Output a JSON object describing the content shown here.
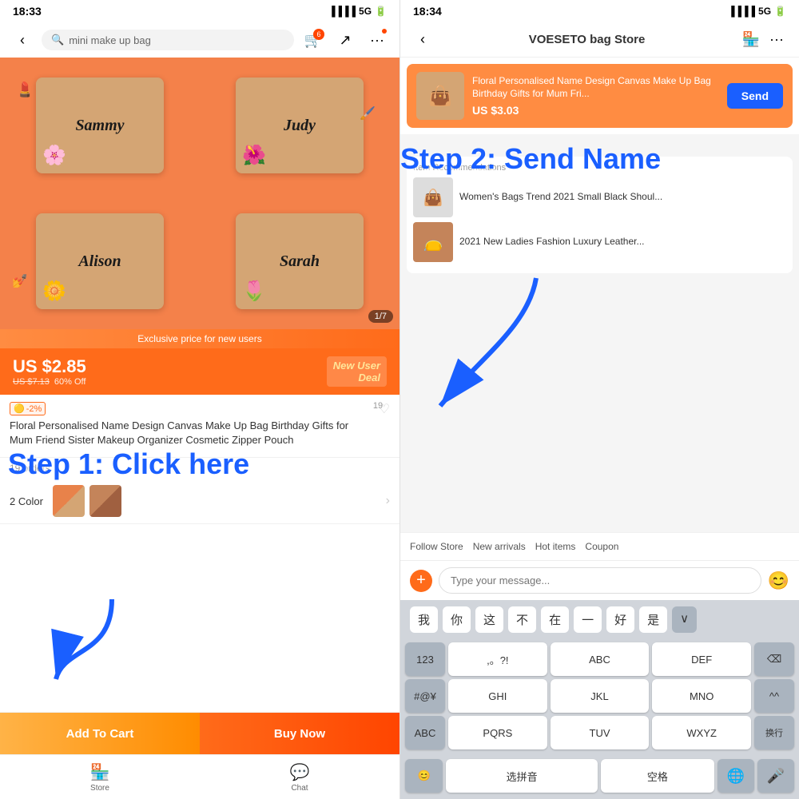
{
  "left": {
    "statusBar": {
      "time": "18:33",
      "signal": "5G"
    },
    "search": {
      "placeholder": "mini make up bag"
    },
    "product": {
      "names": [
        "Sammy",
        "Judy",
        "Alison",
        "Sarah"
      ],
      "imageCounter": "1/7",
      "exclusiveBanner": "Exclusive price for new users",
      "currentPrice": "US $2.85",
      "originalPrice": "US $7.13",
      "discount": "60% Off",
      "newUserDeal": "New User\nDeal",
      "tag": "-2%",
      "title": "Floral Personalised Name Design Canvas Make Up Bag Birthday Gifts for Mum Friend Sister Makeup Organizer Cosmetic Zipper Pouch",
      "orders": "19 orders",
      "colorLabel": "2 Color",
      "likeCount": "19"
    },
    "bottomNav": {
      "storeLabel": "Store",
      "chatLabel": "Chat",
      "addToCart": "Add To Cart",
      "buyNow": "Buy Now"
    },
    "step1Text": "Step 1: Click here"
  },
  "right": {
    "statusBar": {
      "time": "18:34",
      "signal": "5G"
    },
    "header": {
      "title": "VOESETO bag Store"
    },
    "productCard": {
      "title": "Floral Personalised Name Design Canvas Make Up Bag Birthday Gifts for Mum Fri...",
      "price": "US $3.03",
      "sendLabel": "Send"
    },
    "step2Text": "Step 2: Send Name",
    "chatSection": {
      "recTitle": "Item Recommendations",
      "items": [
        {
          "title": "Women's Bags Trend 2021 Small Black Shoul..."
        },
        {
          "title": "2021 New Ladies Fashion Luxury Leather..."
        }
      ]
    },
    "tabs": [
      "Follow Store",
      "New arrivals",
      "Hot items",
      "Coupon"
    ],
    "inputPlaceholder": "Type your message...",
    "keyboard": {
      "quickWords": [
        "我",
        "你",
        "这",
        "不",
        "在",
        "一",
        "好",
        "是"
      ],
      "row1": [
        "123",
        ",。?!",
        "ABC",
        "DEF",
        "⌫"
      ],
      "row2": [
        "#@¥",
        "GHI",
        "JKL",
        "MNO",
        "^^"
      ],
      "row3": [
        "ABC",
        "PQRS",
        "TUV",
        "WXYZ",
        "换行"
      ],
      "row4emoji": "😊",
      "row4pinyin": "选拼音",
      "row4space": "空格",
      "globeLabel": "🌐",
      "micLabel": "🎤"
    }
  }
}
